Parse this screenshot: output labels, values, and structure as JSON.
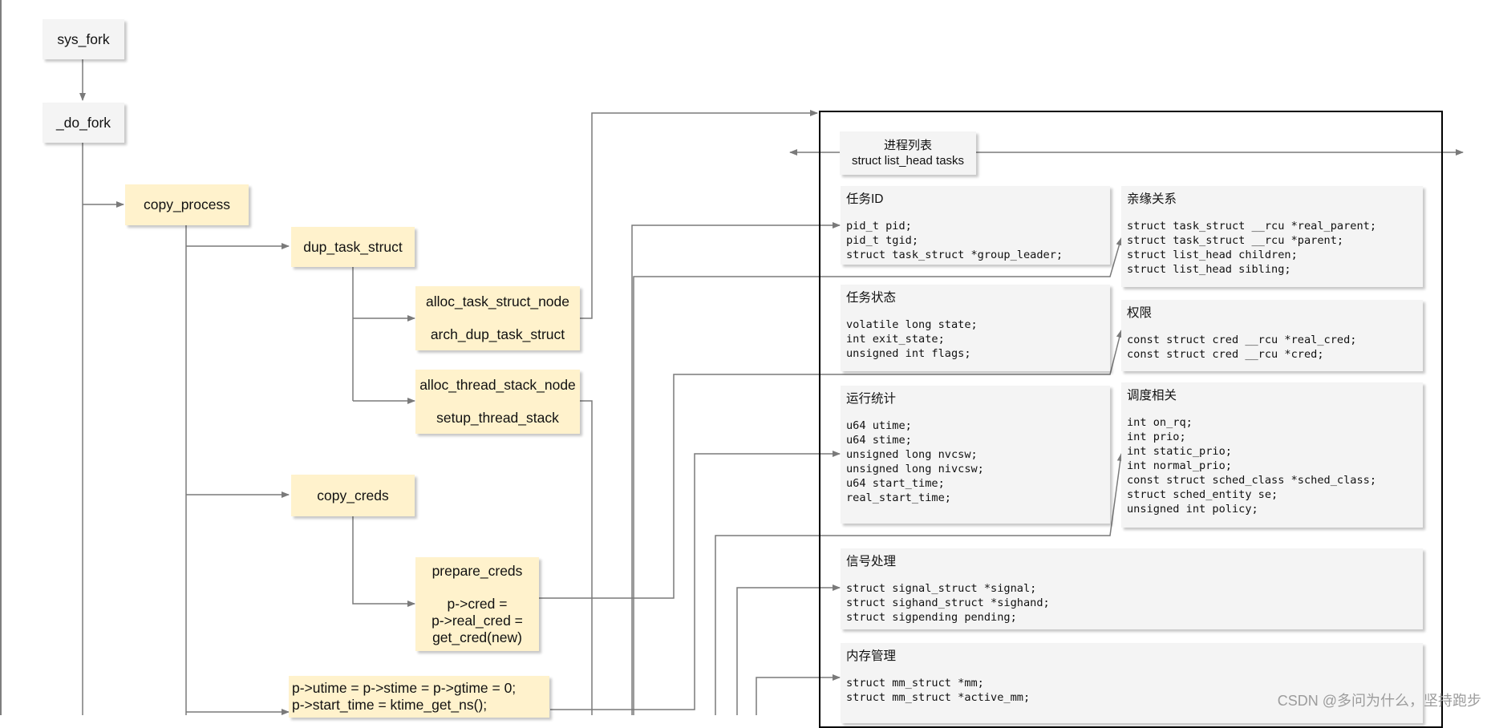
{
  "nodes": {
    "sys_fork": "sys_fork",
    "do_fork": "_do_fork",
    "copy_process": "copy_process",
    "dup_task_struct": "dup_task_struct",
    "alloc_task_struct_node": "alloc_task_struct_node",
    "arch_dup_task_struct": "arch_dup_task_struct",
    "alloc_thread_stack_node": "alloc_thread_stack_node",
    "setup_thread_stack": "setup_thread_stack",
    "copy_creds": "copy_creds",
    "prepare_creds": "prepare_creds",
    "cred_assign_1": "p->cred =",
    "cred_assign_2": "p->real_cred =",
    "cred_assign_3": "get_cred(new)",
    "time_line_1": "p->utime = p->stime = p->gtime = 0;",
    "time_line_2": "p->start_time = ktime_get_ns();"
  },
  "task_list": {
    "title": "进程列表",
    "subtitle": "struct list_head tasks"
  },
  "cards": {
    "task_id": {
      "title": "任务ID",
      "code": "pid_t pid;\npid_t tgid;\nstruct task_struct *group_leader;"
    },
    "kinship": {
      "title": "亲缘关系",
      "code": "struct task_struct __rcu *real_parent;\nstruct task_struct __rcu *parent;\nstruct list_head children;\nstruct list_head sibling;"
    },
    "task_state": {
      "title": "任务状态",
      "code": "volatile long state;\nint exit_state;\nunsigned int flags;"
    },
    "permissions": {
      "title": "权限",
      "code": "const struct cred __rcu *real_cred;\nconst struct cred __rcu *cred;"
    },
    "runtime_stats": {
      "title": "运行统计",
      "code": "u64 utime;\nu64 stime;\nunsigned long nvcsw;\nunsigned long nivcsw;\nu64 start_time;\nreal_start_time;"
    },
    "scheduling": {
      "title": "调度相关",
      "code": "int on_rq;\nint prio;\nint static_prio;\nint normal_prio;\nconst struct sched_class *sched_class;\nstruct sched_entity se;\nunsigned int policy;"
    },
    "signals": {
      "title": "信号处理",
      "code": "struct signal_struct *signal;\nstruct sighand_struct *sighand;\nstruct sigpending pending;"
    },
    "memory": {
      "title": "内存管理",
      "code": "struct mm_struct *mm;\nstruct mm_struct *active_mm;"
    }
  },
  "watermark": "CSDN @多问为什么，坚持跑步",
  "colors": {
    "node_gray": "#f4f4f4",
    "node_yellow": "#fff2cc",
    "edge": "#7a7a7a",
    "container_border": "#000000"
  }
}
